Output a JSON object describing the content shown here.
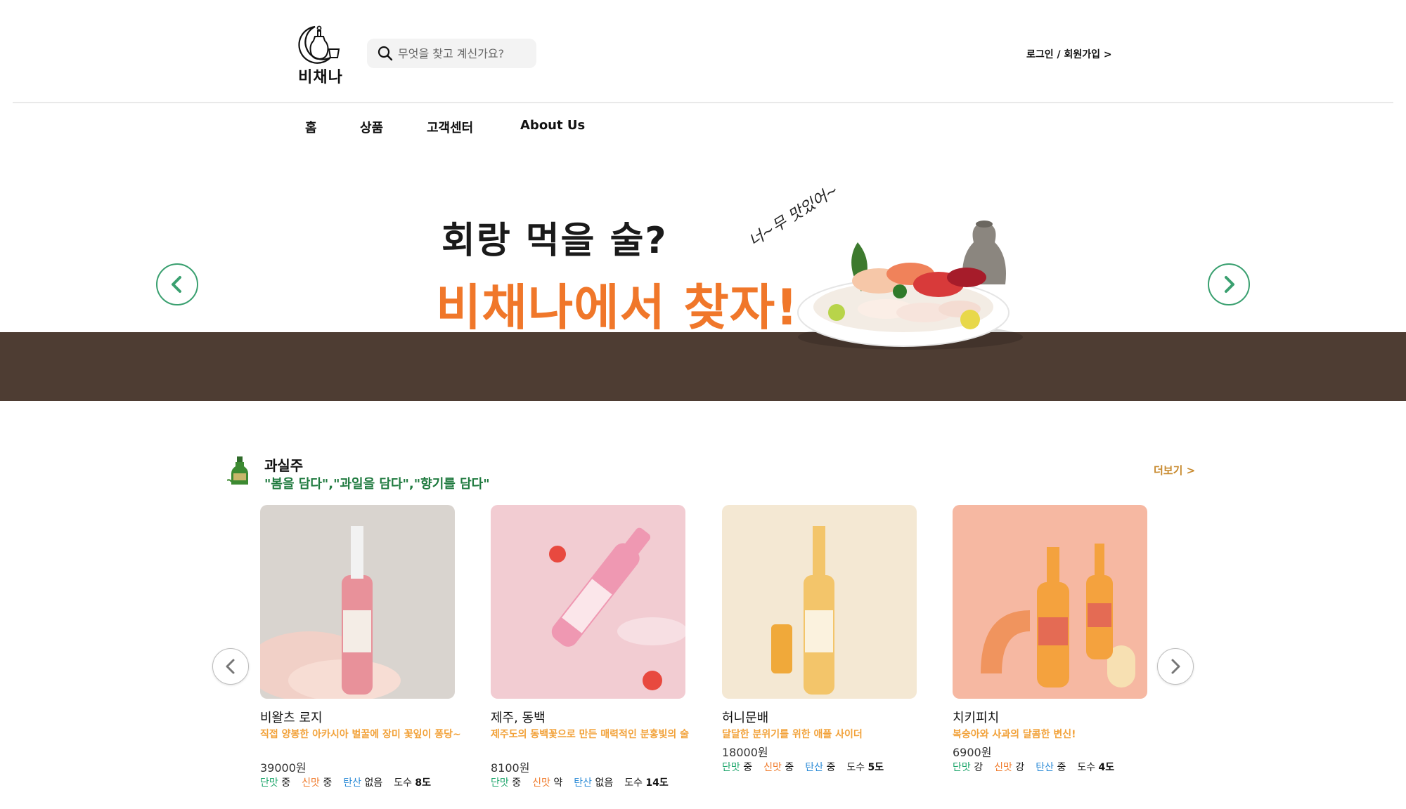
{
  "header": {
    "logo_text": "비채나",
    "search_placeholder": "무엇을 찾고 계신가요?",
    "auth_link": "로그인 / 회원가입 >"
  },
  "nav": {
    "items": [
      {
        "label": "홈"
      },
      {
        "label": "상품"
      },
      {
        "label": "고객센터"
      },
      {
        "label": "About Us"
      }
    ]
  },
  "banner": {
    "headline_line1": "회랑 먹을 술?",
    "headline_line2": "비채나에서 찾자!",
    "handwritten": "너~무 맛있어~",
    "colors": {
      "band": "#4e3d33",
      "headline_accent": "#f0772a",
      "arrow": "#3aa070"
    }
  },
  "section": {
    "icon": "bottle-icon",
    "title": "과실주",
    "subtitle": "\"봄을 담다\",\"과일을 담다\",\"향기를 담다\"",
    "more_link": "더보기 >"
  },
  "tag_labels": {
    "sweet": "단맛",
    "sour": "신맛",
    "carbonation": "탄산",
    "abv": "도수"
  },
  "products": [
    {
      "name": "비왈츠 로지",
      "desc": "직접 양봉한 아카시아 벌꿀에 장미 꽃잎이 퐁당~",
      "price": "39000원",
      "sweet": "중",
      "sour": "중",
      "carbonation": "없음",
      "abv": "8도"
    },
    {
      "name": "제주, 동백",
      "desc": "제주도의 동백꽃으로 만든 매력적인 분홍빛의 술",
      "price": "8100원",
      "sweet": "중",
      "sour": "약",
      "carbonation": "없음",
      "abv": "14도"
    },
    {
      "name": "허니문배",
      "desc": "달달한 분위기를 위한 애플 사이더",
      "price": "18000원",
      "sweet": "중",
      "sour": "중",
      "carbonation": "중",
      "abv": "5도"
    },
    {
      "name": "치키피치",
      "desc": "복숭아와 사과의 달콤한 변신!",
      "price": "6900원",
      "sweet": "강",
      "sour": "강",
      "carbonation": "중",
      "abv": "4도"
    }
  ]
}
